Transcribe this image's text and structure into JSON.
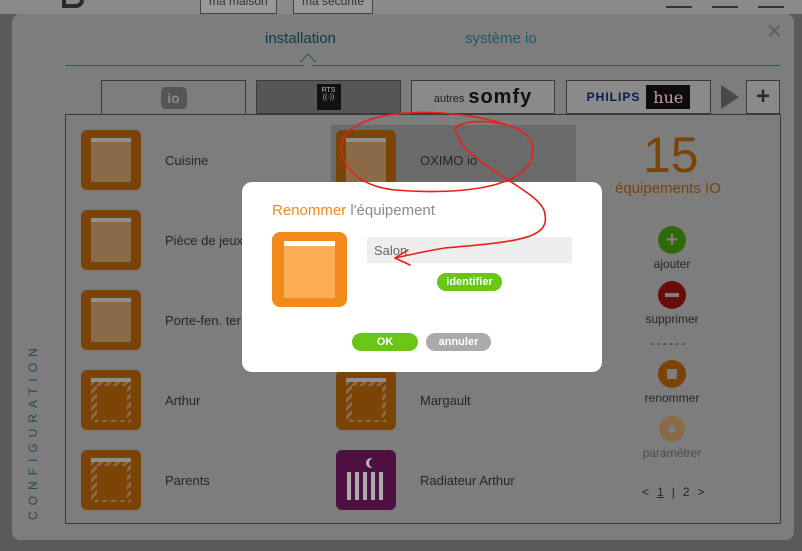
{
  "header": {
    "tabs": [
      "ma maison",
      "ma sécurité"
    ]
  },
  "nav": {
    "installation": "installation",
    "systeme": "système io"
  },
  "protocols": {
    "io": "io",
    "rts": "RTS",
    "somfy_prefix": "autres",
    "somfy": "somfy",
    "philips": "PHILIPS",
    "hue": "hue"
  },
  "side_label": "CONFIGURATION",
  "devices": {
    "left": [
      "Cuisine",
      "Pièce de jeux",
      "Porte-fen. ter",
      "Arthur",
      "Parents"
    ],
    "right": [
      "OXIMO io",
      "Margault",
      "Radiateur Arthur"
    ]
  },
  "stats": {
    "count": "15",
    "label": "équipements IO"
  },
  "actions": {
    "add": "ajouter",
    "delete": "supprimer",
    "separator": "------",
    "rename": "renommer",
    "settings": "paramétrer"
  },
  "pager": {
    "prev": "<",
    "current": "1",
    "sep": "|",
    "next_page": "2",
    "next": ">"
  },
  "dialog": {
    "title_action": "Renommer",
    "title_object": " l'équipement",
    "input_value": "Salon",
    "identify": "identifier",
    "ok": "OK",
    "cancel": "annuler"
  },
  "colors": {
    "accent_orange": "#f28a1a",
    "button_green": "#6ac616",
    "button_grey": "#aaaaaa",
    "annotation_red": "#e8201a"
  }
}
